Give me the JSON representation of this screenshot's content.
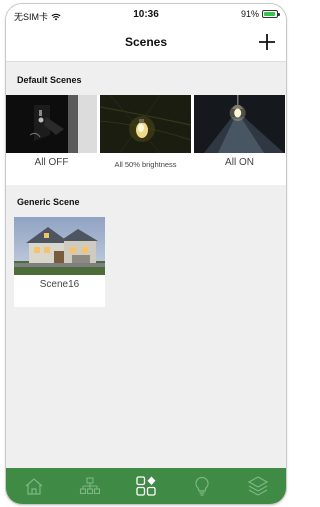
{
  "status_bar": {
    "carrier": "无SIM卡",
    "time": "10:36",
    "battery": "91%",
    "battery_level": 0.91
  },
  "nav": {
    "title": "Scenes",
    "add_icon": "plus-icon"
  },
  "default_scenes": {
    "header": "Default Scenes",
    "items": [
      {
        "label": "All OFF"
      },
      {
        "label": "All 50% brightness"
      },
      {
        "label": "All ON"
      }
    ]
  },
  "generic_scenes": {
    "header": "Generic Scene",
    "items": [
      {
        "label": "Scene16"
      }
    ]
  },
  "tab_bar": {
    "color": "#3f8a44",
    "tabs": [
      {
        "icon": "home-icon"
      },
      {
        "icon": "network-icon"
      },
      {
        "icon": "scenes-icon",
        "active": true
      },
      {
        "icon": "lightbulb-icon"
      },
      {
        "icon": "layers-icon"
      }
    ]
  }
}
